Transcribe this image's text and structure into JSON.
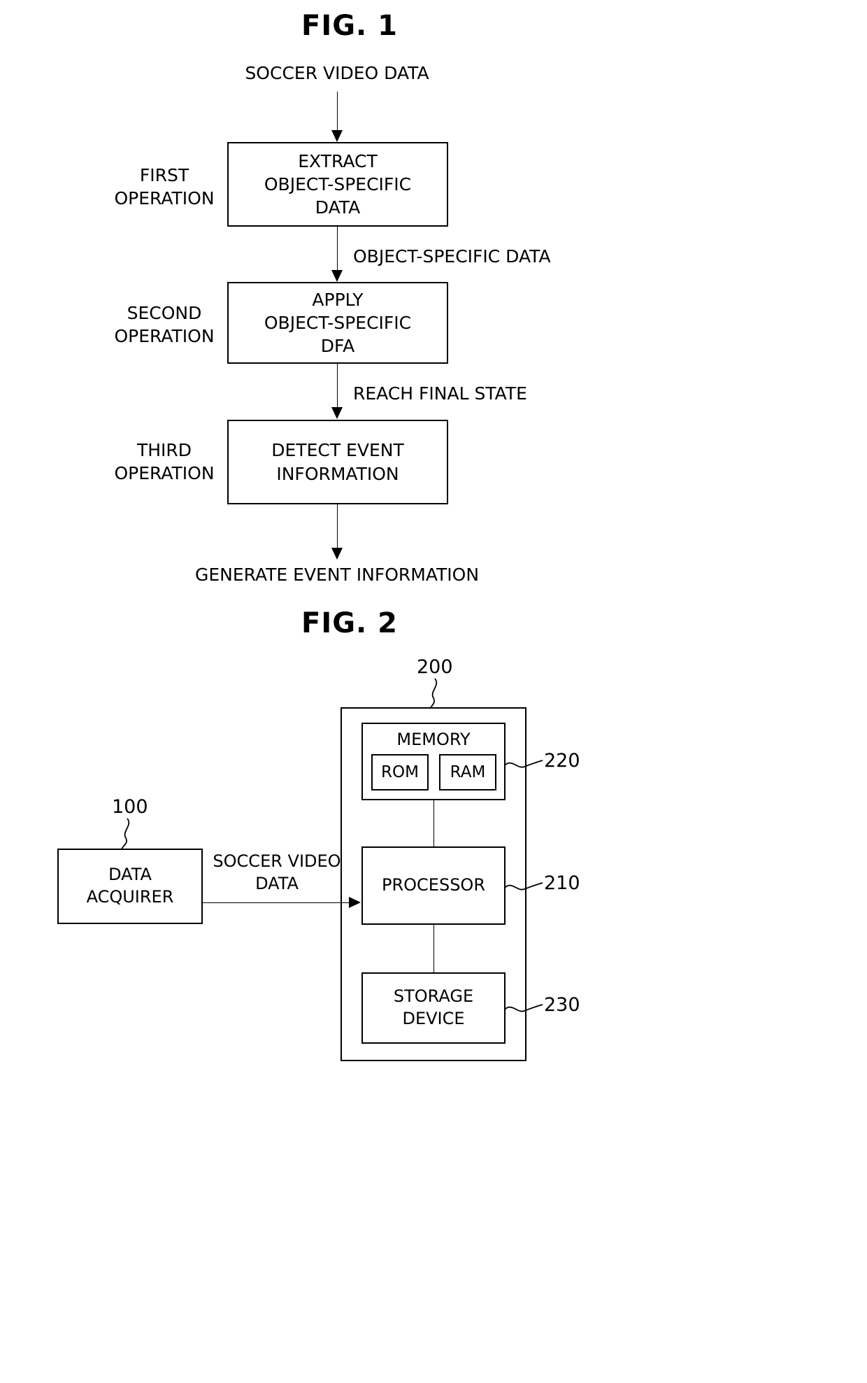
{
  "figures": [
    {
      "title": "FIG. 1",
      "input_label": "SOCCER VIDEO DATA",
      "output_label": "GENERATE EVENT INFORMATION",
      "steps": [
        {
          "side_label": "FIRST\nOPERATION",
          "box_label": "EXTRACT\nOBJECT-SPECIFIC\nDATA",
          "outgoing_edge_label": "OBJECT-SPECIFIC DATA"
        },
        {
          "side_label": "SECOND\nOPERATION",
          "box_label": "APPLY\nOBJECT-SPECIFIC\nDFA",
          "outgoing_edge_label": "REACH FINAL STATE"
        },
        {
          "side_label": "THIRD\nOPERATION",
          "box_label": "DETECT EVENT\nINFORMATION",
          "outgoing_edge_label": ""
        }
      ]
    },
    {
      "title": "FIG. 2",
      "system_ref": "200",
      "edge_label": "SOCCER VIDEO\nDATA",
      "acquirer": {
        "label": "DATA\nACQUIRER",
        "ref": "100"
      },
      "blocks": [
        {
          "label": "MEMORY",
          "ref": "220",
          "children": [
            {
              "label": "ROM"
            },
            {
              "label": "RAM"
            }
          ]
        },
        {
          "label": "PROCESSOR",
          "ref": "210",
          "children": []
        },
        {
          "label": "STORAGE\nDEVICE",
          "ref": "230",
          "children": []
        }
      ]
    }
  ],
  "colors": {
    "ink": "#000000",
    "paper": "#ffffff"
  }
}
